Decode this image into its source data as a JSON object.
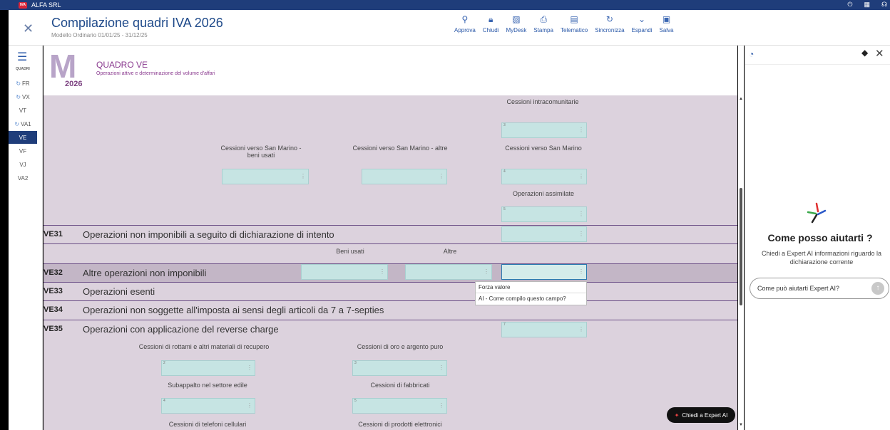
{
  "app": {
    "company": "ALFA SRL",
    "logo_text": "IVA"
  },
  "header": {
    "title": "Compilazione quadri IVA 2026",
    "subtitle": "Modello Ordinario 01/01/25 - 31/12/25"
  },
  "toolbar": [
    {
      "label": "Approva",
      "icon": "user-check-icon",
      "glyph": "⚲"
    },
    {
      "label": "Chiudi",
      "icon": "lock-icon",
      "glyph": "🔒︎"
    },
    {
      "label": "MyDesk",
      "icon": "image-icon",
      "glyph": "▨"
    },
    {
      "label": "Stampa",
      "icon": "print-icon",
      "glyph": "⎙"
    },
    {
      "label": "Telematico",
      "icon": "doc-icon",
      "glyph": "▤"
    },
    {
      "label": "Sincronizza",
      "icon": "sync-icon",
      "glyph": "↻"
    },
    {
      "label": "Espandi",
      "icon": "chevron-down-icon",
      "glyph": "⌄"
    },
    {
      "label": "Salva",
      "icon": "save-icon",
      "glyph": "▣"
    }
  ],
  "nav": {
    "menu_label": "QUADRI",
    "items": [
      {
        "label": "FR",
        "ref": true
      },
      {
        "label": "VX",
        "ref": true
      },
      {
        "label": "VT",
        "ref": false
      },
      {
        "label": "VA1",
        "ref": true
      },
      {
        "label": "VE",
        "ref": false,
        "active": true
      },
      {
        "label": "VF",
        "ref": false
      },
      {
        "label": "VJ",
        "ref": false
      },
      {
        "label": "VA2",
        "ref": false
      }
    ]
  },
  "quadro": {
    "logo_year": "2026",
    "title": "QUADRO VE",
    "subtitle": "Operazioni attive e determinazione del volume d'affari"
  },
  "labels": {
    "cess_intra": "Cessioni intracomunitarie",
    "sm_beni_usati": "Cessioni verso San Marino - beni usati",
    "sm_altre": "Cessioni verso San Marino - altre",
    "sm": "Cessioni verso San Marino",
    "op_assimilate": "Operazioni assimilate",
    "beni_usati": "Beni usati",
    "altre": "Altre",
    "rottami": "Cessioni di rottami e altri materiali di recupero",
    "oro": "Cessioni di oro e argento puro",
    "subappalto": "Subappalto nel settore edile",
    "fabbricati": "Cessioni di fabbricati",
    "telefoni": "Cessioni di telefoni cellulari",
    "elettronici": "Cessioni di prodotti elettronici"
  },
  "fields": {
    "n3": "3",
    "n4": "4",
    "n5": "5",
    "n2": "2",
    "n7": "7",
    "dots": "⋮"
  },
  "rows": [
    {
      "code": "VE31",
      "desc": "Operazioni non imponibili a seguito di dichiarazione di intento"
    },
    {
      "code": "VE32",
      "desc": "Altre operazioni non imponibili"
    },
    {
      "code": "VE33",
      "desc": "Operazioni esenti"
    },
    {
      "code": "VE34",
      "desc": "Operazioni non soggette all'imposta ai sensi degli articoli da 7 a 7-septies"
    },
    {
      "code": "VE35",
      "desc": "Operazioni con applicazione del reverse charge"
    }
  ],
  "context_menu": {
    "force": "Forza valore",
    "ai": "AI - Come compilo questo campo?"
  },
  "expert_button": "Chiedi a Expert AI",
  "assistant": {
    "heading": "Come posso aiutarti ?",
    "text": "Chiedi a Expert AI informazioni riguardo la dichiarazione corrente",
    "placeholder": "Come può aiutarti Expert AI?"
  }
}
